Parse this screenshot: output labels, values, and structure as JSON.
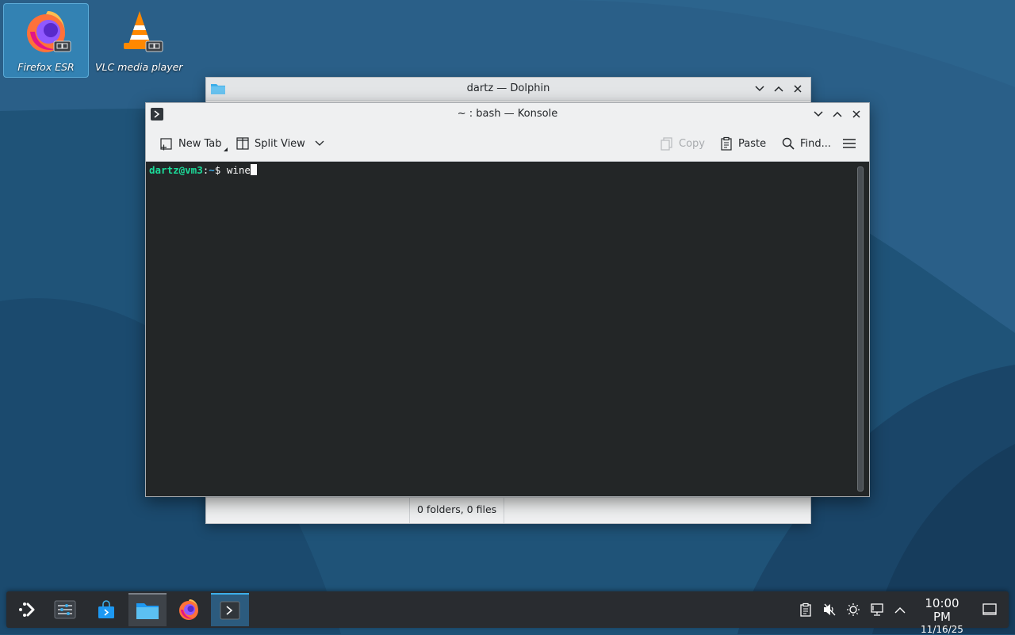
{
  "desktop": {
    "icons": [
      {
        "label": "Firefox ESR"
      },
      {
        "label": "VLC media player"
      }
    ]
  },
  "dolphin": {
    "title": "dartz — Dolphin",
    "status": "0 folders, 0 files"
  },
  "konsole": {
    "title": "~ : bash — Konsole",
    "toolbar": {
      "new_tab": "New Tab",
      "split_view": "Split View",
      "copy": "Copy",
      "paste": "Paste",
      "find": "Find..."
    },
    "terminal": {
      "user_host": "dartz@vm3",
      "sep": ":",
      "path": "~",
      "dollar": "$ ",
      "command": "wine"
    }
  },
  "taskbar": {
    "clock_time": "10:00 PM",
    "clock_date": "11/16/25"
  },
  "colors": {
    "accent": "#3daee9",
    "terminal_bg": "#232627",
    "prompt_user": "#1cdc9a",
    "prompt_path": "#3daee9"
  }
}
